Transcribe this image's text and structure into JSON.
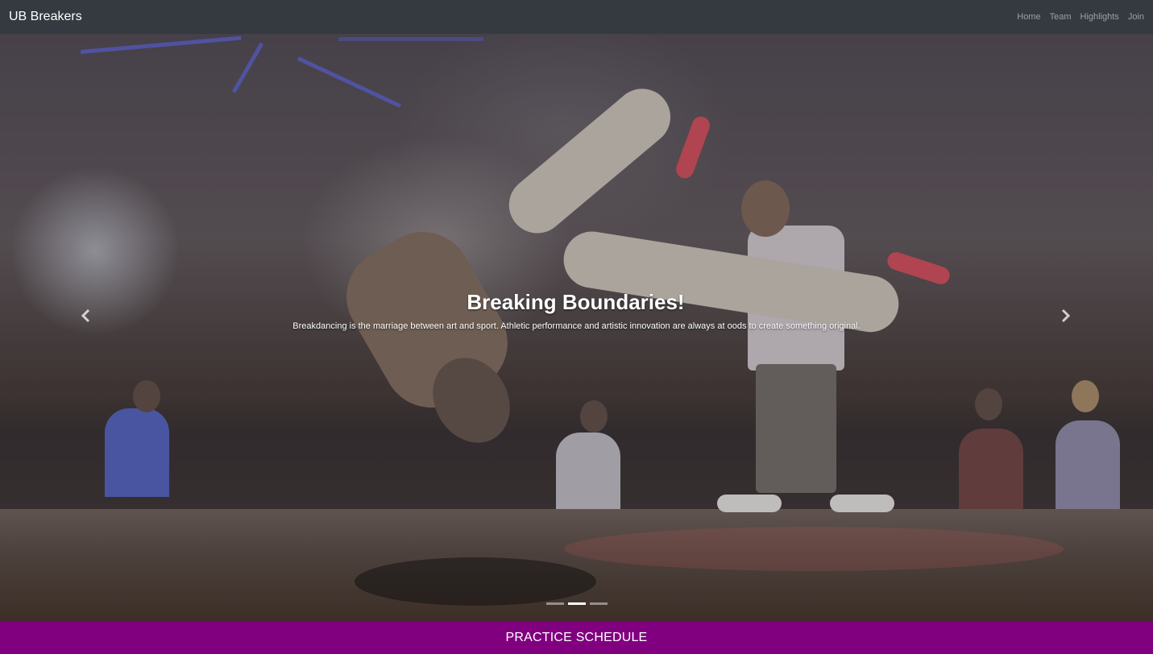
{
  "navbar": {
    "brand": "UB Breakers",
    "links": [
      "Home",
      "Team",
      "Highlights",
      "Join"
    ]
  },
  "carousel": {
    "active_slide": 2,
    "slide_count": 3,
    "caption": {
      "title": "Breaking Boundaries!",
      "text": "Breakdancing is the marriage between art and sport. Athletic performance and artistic innovation are always at oods to create something original."
    },
    "prev_icon": "chevron-left-icon",
    "next_icon": "chevron-right-icon"
  },
  "schedule": {
    "title": "PRACTICE SCHEDULE"
  },
  "colors": {
    "navbar_bg": "#343a40",
    "schedule_bg": "#800080",
    "nav_link": "#9aa0a6"
  }
}
